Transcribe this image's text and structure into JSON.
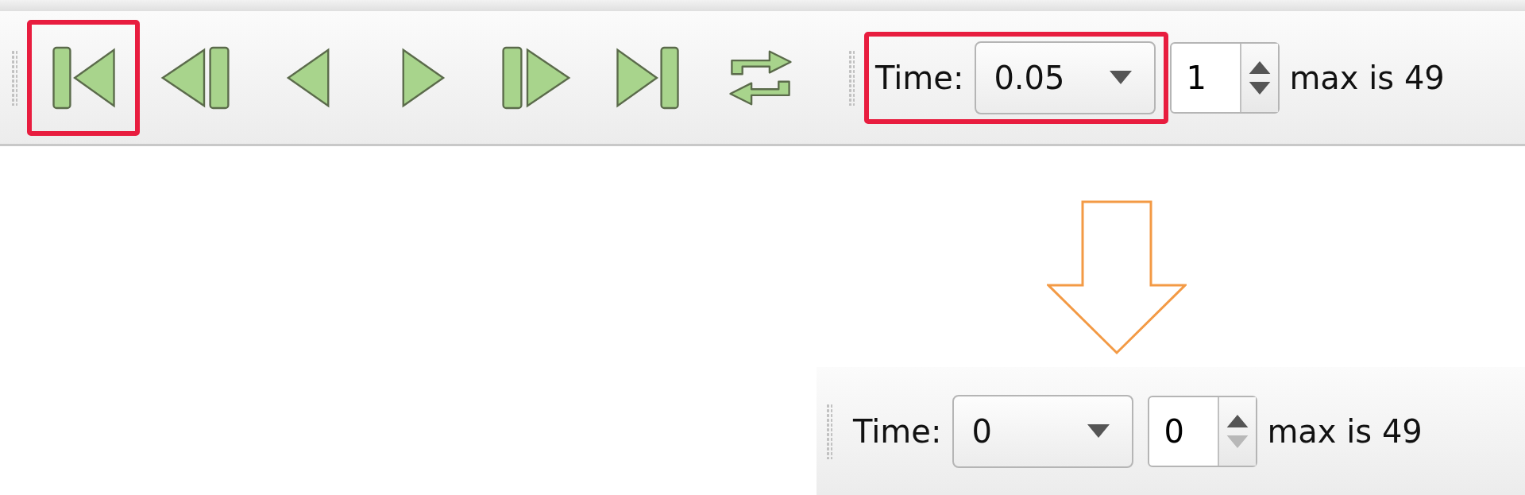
{
  "toolbars": [
    {
      "buttons": [
        {
          "kind": "first",
          "highlighted": true
        },
        {
          "kind": "step_back",
          "highlighted": false
        },
        {
          "kind": "back",
          "highlighted": false
        },
        {
          "kind": "play",
          "highlighted": false
        },
        {
          "kind": "step_forward",
          "highlighted": false
        },
        {
          "kind": "last",
          "highlighted": false
        },
        {
          "kind": "loop",
          "highlighted": false
        }
      ],
      "time": {
        "label": "Time:",
        "value": "0.05",
        "highlighted": true
      },
      "spinner": {
        "value": "1",
        "down_enabled": true
      },
      "max_text": "max is 49"
    },
    {
      "time": {
        "label": "Time:",
        "value": "0",
        "highlighted": false
      },
      "spinner": {
        "value": "0",
        "down_enabled": false
      },
      "max_text": "max is 49"
    }
  ]
}
